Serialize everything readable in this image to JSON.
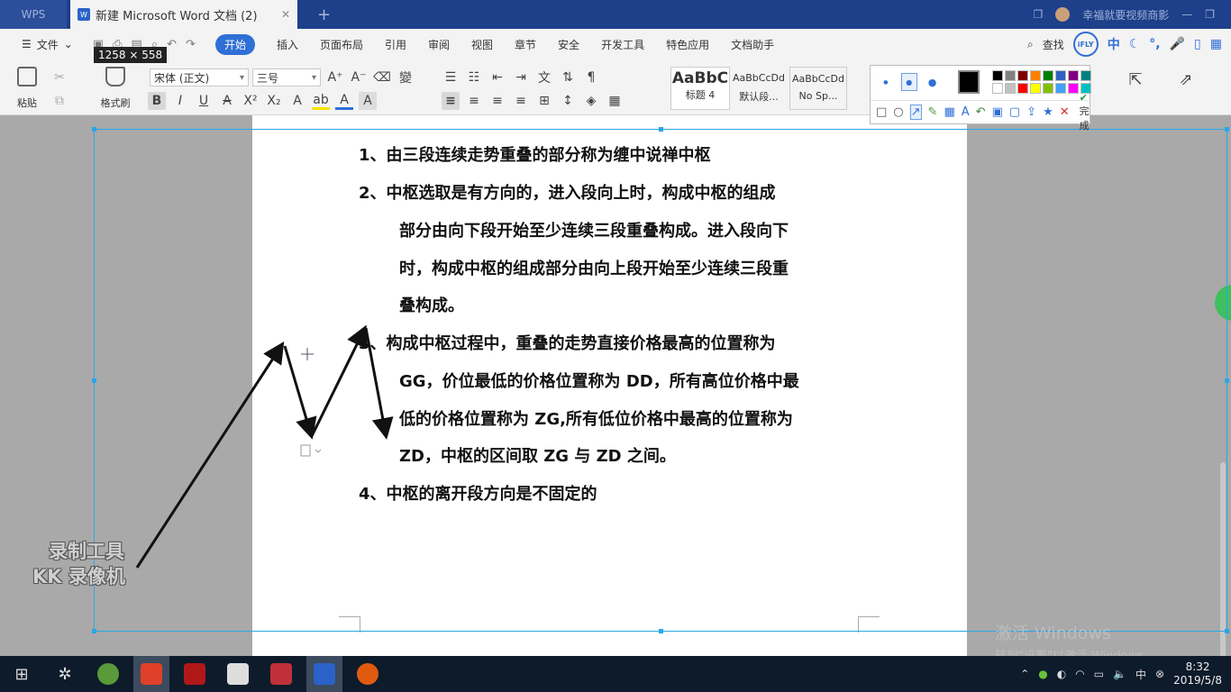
{
  "titlebar": {
    "app_tab": "WPS",
    "doc_tab": "新建 Microsoft Word 文档 (2)",
    "add_tab": "+",
    "right_text": "幸福就要视频商影"
  },
  "menubar": {
    "file": "文件",
    "items": [
      "开始",
      "插入",
      "页面布局",
      "引用",
      "审阅",
      "视图",
      "章节",
      "安全",
      "开发工具",
      "特色应用",
      "文档助手"
    ],
    "active": "开始",
    "search": "查找",
    "ifly": "iFLY",
    "ime": "中"
  },
  "ribbon": {
    "paste_label": "粘贴",
    "format_painter_label": "格式刷",
    "font_name": "宋体 (正文)",
    "font_size": "三号",
    "styles": [
      {
        "sample": "AaBbC",
        "label": "标题 4"
      },
      {
        "sample": "AaBbCcDd",
        "label": "默认段..."
      },
      {
        "sample": "AaBbCcDd",
        "label": "No Sp..."
      }
    ]
  },
  "size_tooltip": "1258 × 558",
  "snip_tool": {
    "done_label": "完成",
    "current_color": "#000000",
    "palette": [
      "#000000",
      "#808080",
      "#800000",
      "#ff8000",
      "#008000",
      "#3060c0",
      "#800080",
      "#008080",
      "#ffffff",
      "#c0c0c0",
      "#ff0000",
      "#ffff00",
      "#80c000",
      "#40a0ff",
      "#ff00ff",
      "#00c0c0"
    ]
  },
  "document": {
    "lines": [
      "1、由三段连续走势重叠的部分称为缠中说禅中枢",
      "2、中枢选取是有方向的，进入段向上时，构成中枢的组成",
      "部分由向下段开始至少连续三段重叠构成。进入段向下",
      "时，构成中枢的组成部分由向上段开始至少连续三段重",
      "叠构成。",
      "3、构成中枢过程中，重叠的走势直接价格最高的位置称为",
      "GG，价位最低的价格位置称为 DD，所有高位价格中最",
      "低的价格位置称为 ZG,所有低位价格中最高的位置称为",
      "ZD，中枢的区间取 ZG 与 ZD 之间。",
      "4、中枢的离开段方向是不固定的"
    ]
  },
  "watermark": {
    "line1": "录制工具",
    "line2": "KK 录像机"
  },
  "activate": {
    "line1": "激活 Windows",
    "line2": "转到\"设置\"以激活 Windows。"
  },
  "taskbar": {
    "time": "8:32",
    "date": "2019/5/8"
  }
}
